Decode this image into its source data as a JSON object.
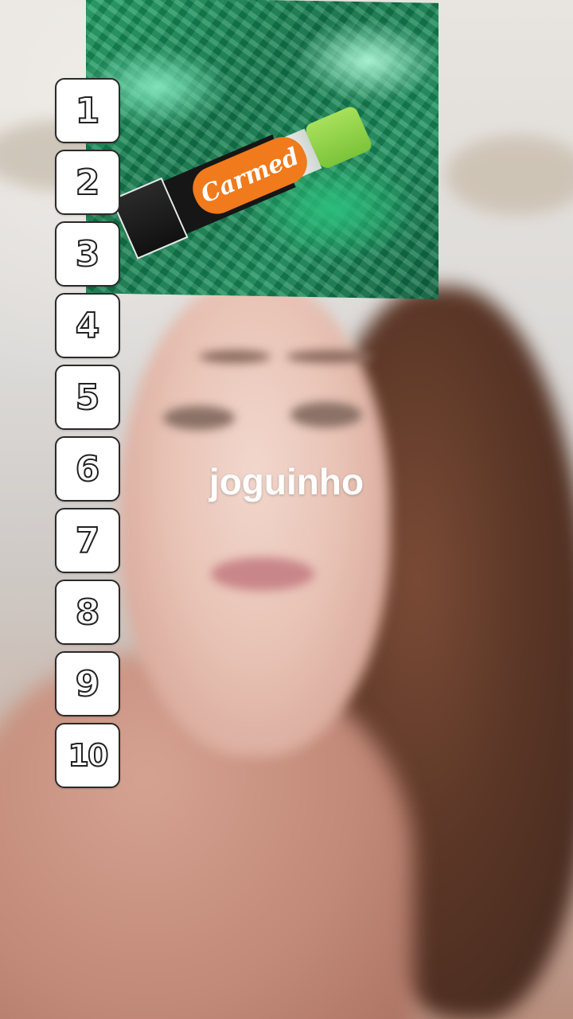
{
  "product": {
    "brand_label": "Carmed"
  },
  "ranking": {
    "slots": [
      "1",
      "2",
      "3",
      "4",
      "5",
      "6",
      "7",
      "8",
      "9",
      "10"
    ]
  },
  "caption": {
    "text": "joguinho"
  }
}
